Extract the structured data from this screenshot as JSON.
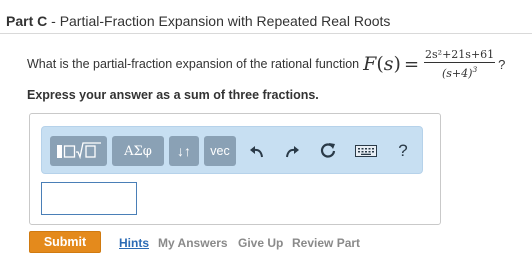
{
  "header": {
    "part_label": "Part C",
    "separator": " - ",
    "title": "Partial-Fraction Expansion with Repeated Real Roots"
  },
  "question": {
    "prompt": "What is the partial-fraction expansion of the rational function",
    "function_name": "F",
    "variable": "s",
    "equals": "=",
    "numerator": "2s²+21s+61",
    "denominator_base": "(s+4)",
    "denominator_exponent": "3",
    "end_mark": "?"
  },
  "instruction": "Express your answer as a sum of three fractions.",
  "toolbar": {
    "greek_label": "ΑΣφ",
    "arrows_label": "↓↑",
    "vec_label": "vec",
    "help_label": "?",
    "icons": [
      "templates-icon",
      "undo-icon",
      "redo-icon",
      "reset-icon",
      "keyboard-icon",
      "help-icon"
    ]
  },
  "answer": {
    "value": ""
  },
  "actions": {
    "submit_label": "Submit",
    "hints_label": "Hints",
    "my_answers_label": "My Answers",
    "give_up_label": "Give Up",
    "review_part_label": "Review Part"
  },
  "colors": {
    "toolbar_bg": "#c7dff2",
    "button_bg": "#8aa1b5",
    "submit_bg": "#e48a1c",
    "link_blue": "#2b6bb5",
    "link_gray": "#8a8a8a"
  }
}
